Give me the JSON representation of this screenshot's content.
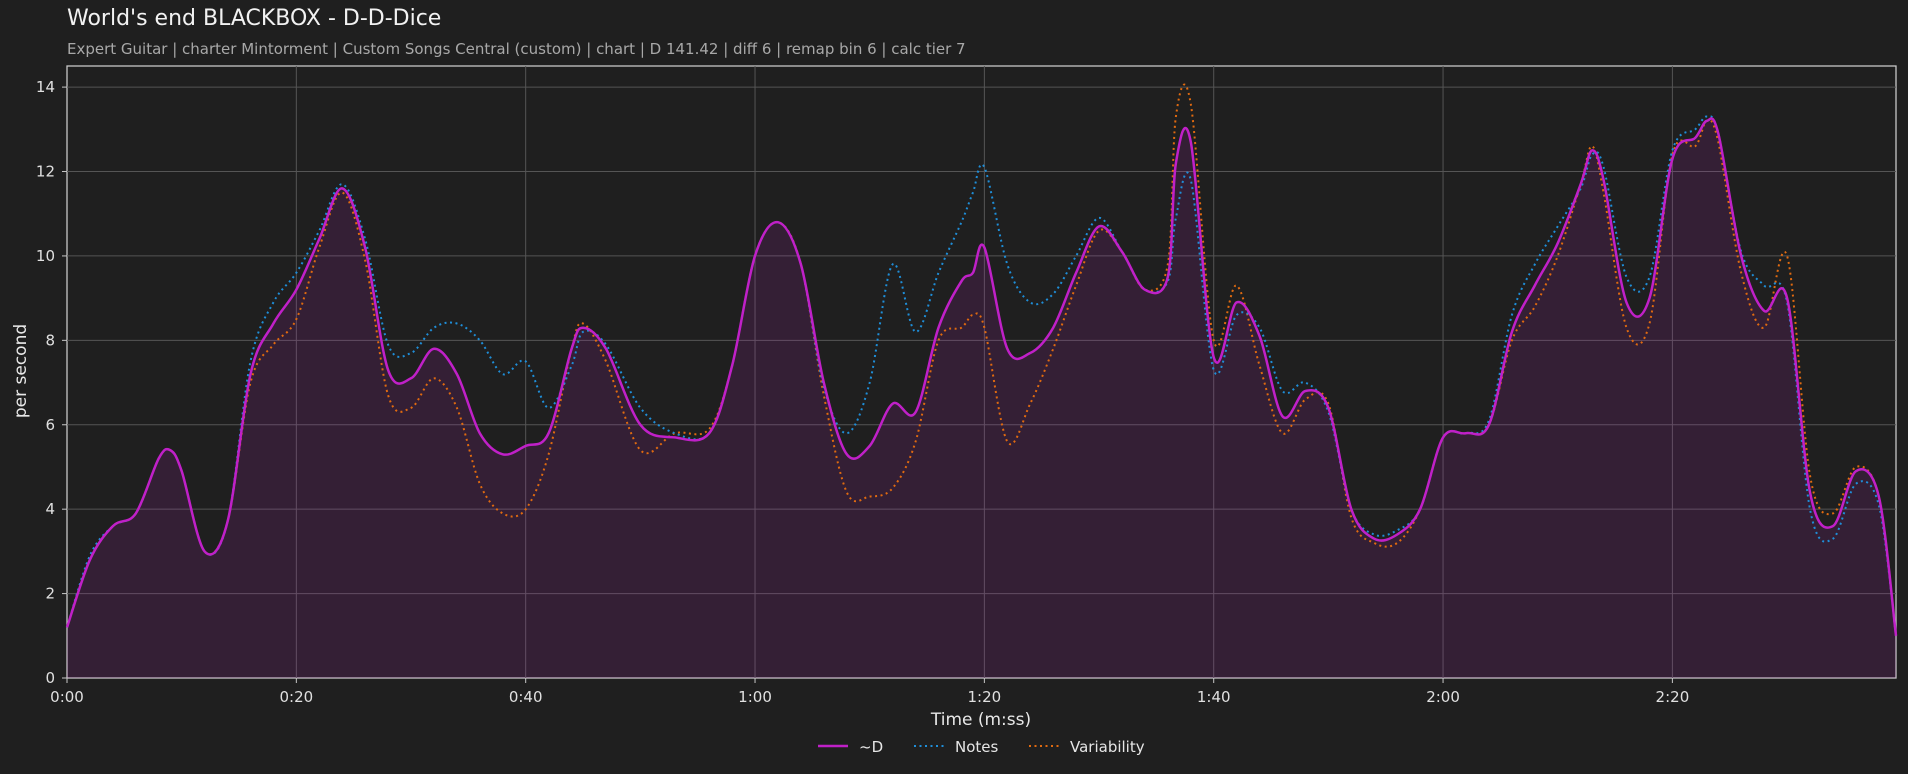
{
  "title": "World's end BLACKBOX - D-D-Dice",
  "subtitle": "Expert Guitar  |  charter Mintorment  |  Custom Songs Central (custom)  |  chart  |  D 141.42  |  diff 6  |  remap bin 6  |  calc tier 7",
  "chart_data": {
    "type": "line",
    "xlabel": "Time (m:ss)",
    "ylabel": "per second",
    "xlim": [
      0,
      159.5
    ],
    "ylim": [
      0,
      14.5
    ],
    "x_ticks": [
      0,
      20,
      40,
      60,
      80,
      100,
      120,
      140
    ],
    "x_tick_labels": [
      "0:00",
      "0:20",
      "0:40",
      "1:00",
      "1:20",
      "1:40",
      "2:00",
      "2:20"
    ],
    "y_ticks": [
      0,
      2,
      4,
      6,
      8,
      10,
      12,
      14
    ],
    "y_tick_labels": [
      "0",
      "2",
      "4",
      "6",
      "8",
      "10",
      "12",
      "14"
    ],
    "grid": true,
    "legend_position": "bottom-center",
    "x": [
      0,
      2,
      4,
      6,
      8,
      9,
      10,
      12,
      14,
      16,
      18,
      20,
      22,
      24,
      26,
      28,
      30,
      32,
      34,
      36,
      38,
      40,
      42,
      44,
      45,
      47,
      50,
      53,
      56,
      58,
      60,
      62,
      64,
      66,
      68,
      70,
      72,
      74,
      76,
      78,
      79,
      80,
      82,
      84,
      86,
      88,
      90,
      92,
      94,
      96,
      96.7,
      98,
      100,
      102,
      104,
      106,
      108,
      110,
      112,
      114,
      116,
      118,
      120,
      122,
      124,
      126,
      128,
      130,
      132,
      133,
      134,
      136,
      138,
      140,
      142,
      143,
      144,
      146,
      148,
      150,
      152,
      154,
      156,
      158,
      159.5
    ],
    "series": [
      {
        "name": "~D",
        "color": "#c020c8",
        "style": "solid",
        "values": [
          1.2,
          2.8,
          3.6,
          3.9,
          5.2,
          5.4,
          4.9,
          3.0,
          3.7,
          7.2,
          8.4,
          9.2,
          10.4,
          11.6,
          10.2,
          7.3,
          7.1,
          7.8,
          7.2,
          5.8,
          5.3,
          5.5,
          5.8,
          7.8,
          8.3,
          7.8,
          6.0,
          5.7,
          5.8,
          7.4,
          10.0,
          10.8,
          9.8,
          7.0,
          5.3,
          5.5,
          6.5,
          6.3,
          8.3,
          9.4,
          9.6,
          10.2,
          7.8,
          7.7,
          8.3,
          9.6,
          10.7,
          10.1,
          9.2,
          9.5,
          12.2,
          12.7,
          7.6,
          8.9,
          8.1,
          6.2,
          6.8,
          6.4,
          4.0,
          3.3,
          3.4,
          4.0,
          5.7,
          5.8,
          6.0,
          8.2,
          9.3,
          10.3,
          11.7,
          12.5,
          11.8,
          8.9,
          9.0,
          12.3,
          12.8,
          13.2,
          12.9,
          10.0,
          8.7,
          9.0,
          4.4,
          3.6,
          4.9,
          4.3,
          1.0
        ]
      },
      {
        "name": "Notes",
        "color": "#1f8ed8",
        "style": "dotted",
        "values": [
          1.2,
          2.9,
          3.6,
          3.9,
          5.2,
          5.4,
          4.9,
          3.0,
          3.7,
          7.5,
          8.9,
          9.6,
          10.6,
          11.7,
          10.4,
          7.9,
          7.7,
          8.3,
          8.4,
          8.0,
          7.2,
          7.5,
          6.4,
          7.4,
          8.2,
          7.9,
          6.4,
          5.8,
          5.8,
          7.4,
          10.0,
          10.8,
          9.8,
          6.9,
          5.8,
          7.0,
          9.8,
          8.2,
          9.6,
          10.8,
          11.5,
          12.1,
          9.8,
          8.9,
          9.1,
          10.0,
          10.9,
          10.1,
          9.2,
          9.4,
          10.9,
          11.8,
          7.3,
          8.6,
          8.3,
          6.8,
          7.0,
          6.3,
          4.0,
          3.4,
          3.5,
          4.0,
          5.7,
          5.8,
          6.1,
          8.6,
          9.8,
          10.7,
          11.6,
          12.4,
          12.1,
          9.5,
          9.5,
          12.5,
          13.0,
          13.3,
          12.9,
          10.1,
          9.3,
          8.9,
          4.0,
          3.3,
          4.6,
          4.1,
          1.0
        ]
      },
      {
        "name": "Variability",
        "color": "#e06a10",
        "style": "dotted",
        "values": [
          1.2,
          2.8,
          3.6,
          3.9,
          5.2,
          5.4,
          4.9,
          3.0,
          3.7,
          7.0,
          7.9,
          8.5,
          10.2,
          11.5,
          9.9,
          6.7,
          6.4,
          7.1,
          6.4,
          4.6,
          3.9,
          4.0,
          5.3,
          7.8,
          8.4,
          7.5,
          5.4,
          5.8,
          5.9,
          7.4,
          10.0,
          10.8,
          9.8,
          6.7,
          4.4,
          4.3,
          4.5,
          5.6,
          8.0,
          8.3,
          8.6,
          8.3,
          5.6,
          6.5,
          7.8,
          9.3,
          10.6,
          10.1,
          9.2,
          9.8,
          13.3,
          13.6,
          8.0,
          9.3,
          7.4,
          5.8,
          6.6,
          6.5,
          3.8,
          3.2,
          3.2,
          4.0,
          5.7,
          5.8,
          6.0,
          8.0,
          8.8,
          10.0,
          11.7,
          12.6,
          11.5,
          8.3,
          8.4,
          12.4,
          12.6,
          13.2,
          12.7,
          9.6,
          8.3,
          10.0,
          4.8,
          3.9,
          5.0,
          4.3,
          1.0
        ]
      }
    ]
  }
}
